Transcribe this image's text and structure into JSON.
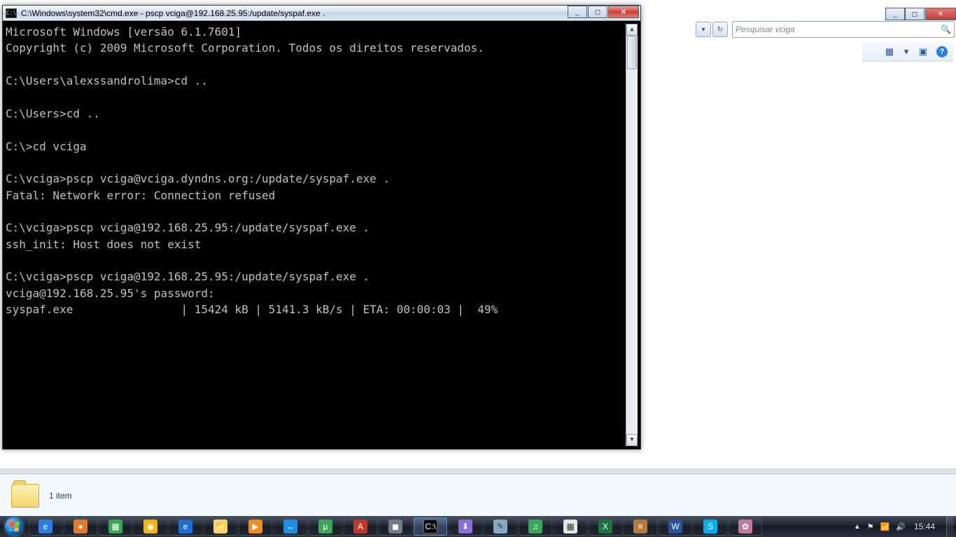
{
  "bg_explorer": {
    "search_placeholder": "Pesquisar vciga",
    "nav_back": "◄",
    "view_icon": "▦",
    "view_drop": "▾",
    "preview_icon": "▣",
    "help_icon": "?"
  },
  "cmd": {
    "title": "C:\\Windows\\system32\\cmd.exe - pscp  vciga@192.168.25.95:/update/syspaf.exe .",
    "icon_label": "C:\\",
    "lines": {
      "l1": "Microsoft Windows [versão 6.1.7601]",
      "l2": "Copyright (c) 2009 Microsoft Corporation. Todos os direitos reservados.",
      "l3": "",
      "l4": "C:\\Users\\alexssandrolima>cd ..",
      "l5": "",
      "l6": "C:\\Users>cd ..",
      "l7": "",
      "l8": "C:\\>cd vciga",
      "l9": "",
      "l10": "C:\\vciga>pscp vciga@vciga.dyndns.org:/update/syspaf.exe .",
      "l11": "Fatal: Network error: Connection refused",
      "l12": "",
      "l13": "C:\\vciga>pscp vciga@192.168.25.95:/update/syspaf.exe .",
      "l14": "ssh_init: Host does not exist",
      "l15": "",
      "l16": "C:\\vciga>pscp vciga@192.168.25.95:/update/syspaf.exe .",
      "l17": "vciga@192.168.25.95's password:",
      "l18": "syspaf.exe                | 15424 kB | 5141.3 kB/s | ETA: 00:00:03 |  49%"
    },
    "min": "_",
    "max": "◻",
    "close": "✕",
    "sb_up": "▲",
    "sb_down": "▼"
  },
  "details": {
    "count": "1 item"
  },
  "tray": {
    "arrow": "▲",
    "flag": "⚑",
    "net": "📶",
    "vol": "🔊",
    "clock": "15:44"
  },
  "taskbar": {
    "items": [
      "ie",
      "ff",
      "wmc",
      "ch",
      "ie2",
      "fld",
      "wmp",
      "tv",
      "ut",
      "ar",
      "gen",
      "cmd",
      "dl",
      "np",
      "ns",
      "cal",
      "xl",
      "db",
      "wd",
      "sk",
      "pt"
    ],
    "glyphs": {
      "ie": "e",
      "ff": "●",
      "wmc": "▦",
      "ch": "◉",
      "ie2": "e",
      "fld": "📁",
      "wmp": "▶",
      "tv": "↔",
      "ut": "µ",
      "ar": "A",
      "gen": "◼",
      "cmd": "C:\\",
      "dl": "⬇",
      "np": "✎",
      "ns": "♫",
      "cal": "▦",
      "xl": "X",
      "db": "≡",
      "wd": "W",
      "sk": "S",
      "pt": "✿"
    }
  }
}
